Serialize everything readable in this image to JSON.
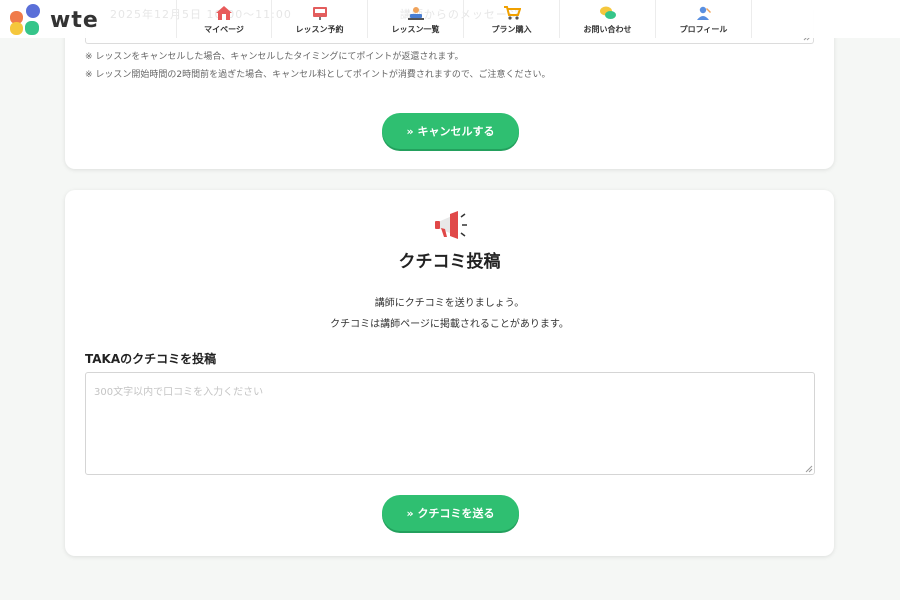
{
  "header": {
    "logo_text": "wte",
    "ghost_text": "2025年12月5日 10:00～11:00　　　　　　　　　講師からのメッセージ",
    "nav": [
      {
        "label": "マイページ",
        "icon": "home-icon"
      },
      {
        "label": "レッスン予約",
        "icon": "reservation-icon"
      },
      {
        "label": "レッスン一覧",
        "icon": "lesson-list-icon"
      },
      {
        "label": "プラン購入",
        "icon": "cart-icon"
      },
      {
        "label": "お問い合わせ",
        "icon": "chat-icon"
      },
      {
        "label": "プロフィール",
        "icon": "profile-icon"
      }
    ]
  },
  "cancel_section": {
    "notes": [
      "※ レッスンをキャンセルした場合、キャンセルしたタイミングにてポイントが返還されます。",
      "※ レッスン開始時間の2時間前を過ぎた場合、キャンセル料としてポイントが消費されますので、ご注意ください。"
    ],
    "cancel_button": "» キャンセルする"
  },
  "review_section": {
    "icon": "megaphone-icon",
    "title": "クチコミ投稿",
    "desc_line1": "講師にクチコミを送りましょう。",
    "desc_line2": "クチコミは講師ページに掲載されることがあります。",
    "form_label": "TAKAのクチコミを投稿",
    "textarea_value": "",
    "textarea_placeholder": "300文字以内で口コミを入力ください",
    "send_button": "» クチコミを送る"
  },
  "colors": {
    "accent": "#2fbf71",
    "background": "#f5f7f5"
  }
}
